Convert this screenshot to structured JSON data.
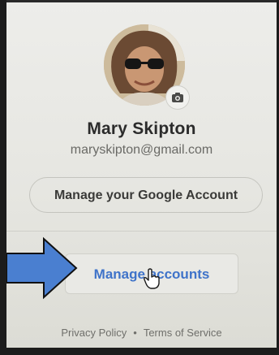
{
  "profile": {
    "name": "Mary Skipton",
    "email": "maryskipton@gmail.com",
    "avatar_icon": "user-photo",
    "camera_icon": "camera-icon"
  },
  "buttons": {
    "manage_google_account": "Manage your Google Account",
    "manage_accounts": "Manage accounts"
  },
  "footer": {
    "privacy": "Privacy Policy",
    "separator": "•",
    "terms": "Terms of Service"
  },
  "colors": {
    "link_blue": "#3f73c9",
    "arrow_blue": "#4a7fd0"
  }
}
